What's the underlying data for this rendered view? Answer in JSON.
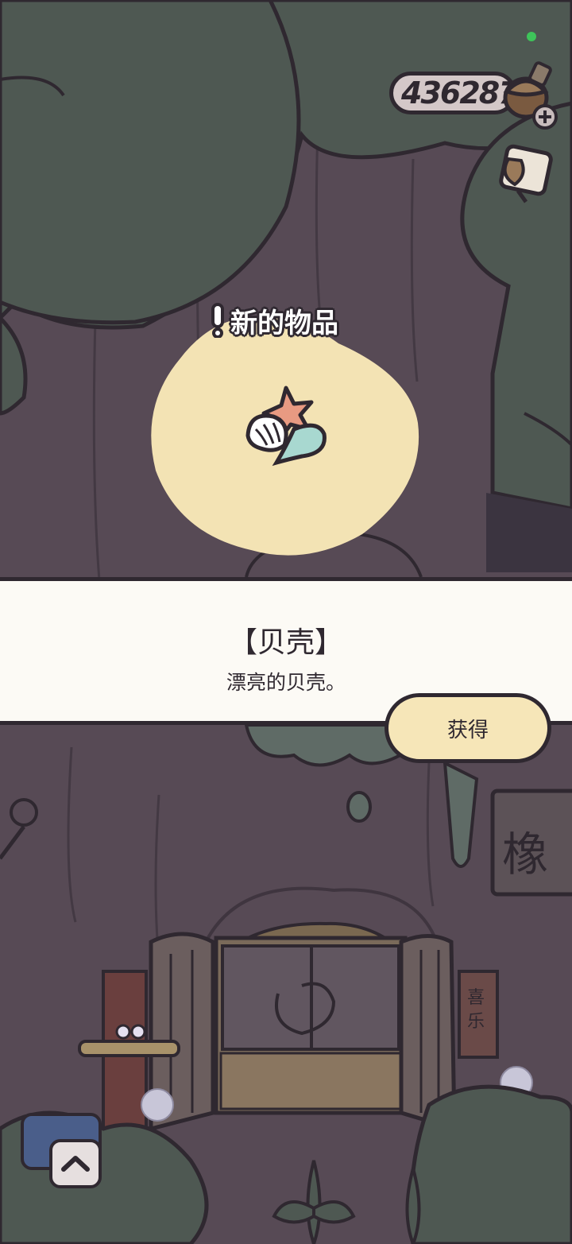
{
  "hud": {
    "acorn_count": "436287",
    "acorn_icon": "acorn-icon",
    "add_icon": "plus-icon",
    "letter_icon": "letter-icon"
  },
  "popup": {
    "heading": "新的物品",
    "item_icon": "seashell-icon",
    "item_name": "【贝壳】",
    "item_description": "漂亮的贝壳。",
    "obtain_label": "获得"
  },
  "scene": {
    "sign_text": "橡",
    "couplet_text": [
      "喜",
      "乐"
    ]
  },
  "controls": {
    "expand_icon": "chevron-up-icon"
  },
  "colors": {
    "panel_bg": "#fcfaf5",
    "button_bg": "#f6e6b8",
    "outline": "#2f2830",
    "tree_green": "#4e5852",
    "bark": "#574a55"
  }
}
